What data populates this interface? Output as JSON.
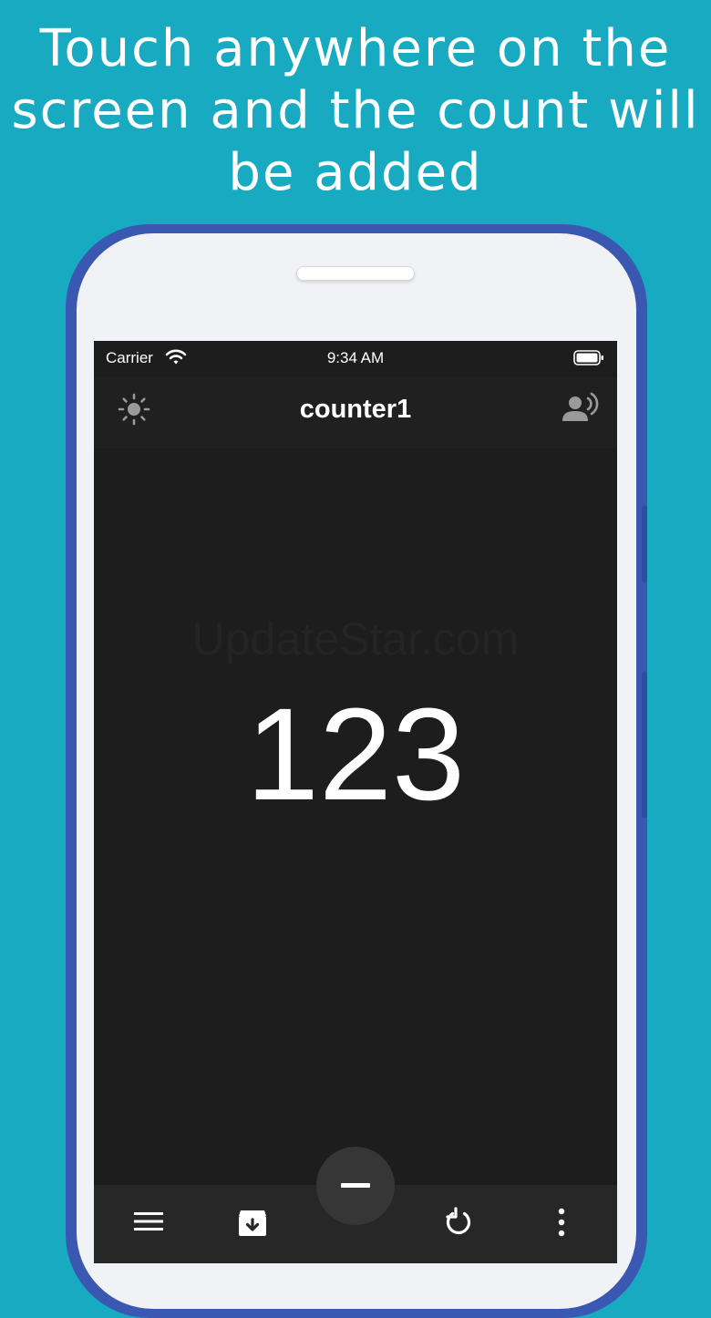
{
  "promo": {
    "headline": "Touch anywhere on the\nscreen and the count will\nbe added"
  },
  "status_bar": {
    "carrier": "Carrier",
    "time": "9:34 AM"
  },
  "navbar": {
    "title": "counter1",
    "left_icon": "brightness-icon",
    "right_icon": "voice-icon"
  },
  "watermark": "UpdateStar.com",
  "counter": {
    "value": "123"
  },
  "bottom_bar": {
    "items": [
      "menu-icon",
      "archive-icon",
      "minus-icon",
      "reset-icon",
      "more-icon"
    ]
  },
  "colors": {
    "background": "#17aac1",
    "phone_frame": "#3a57b2",
    "screen": "#1d1d1d",
    "text": "#ffffff"
  }
}
